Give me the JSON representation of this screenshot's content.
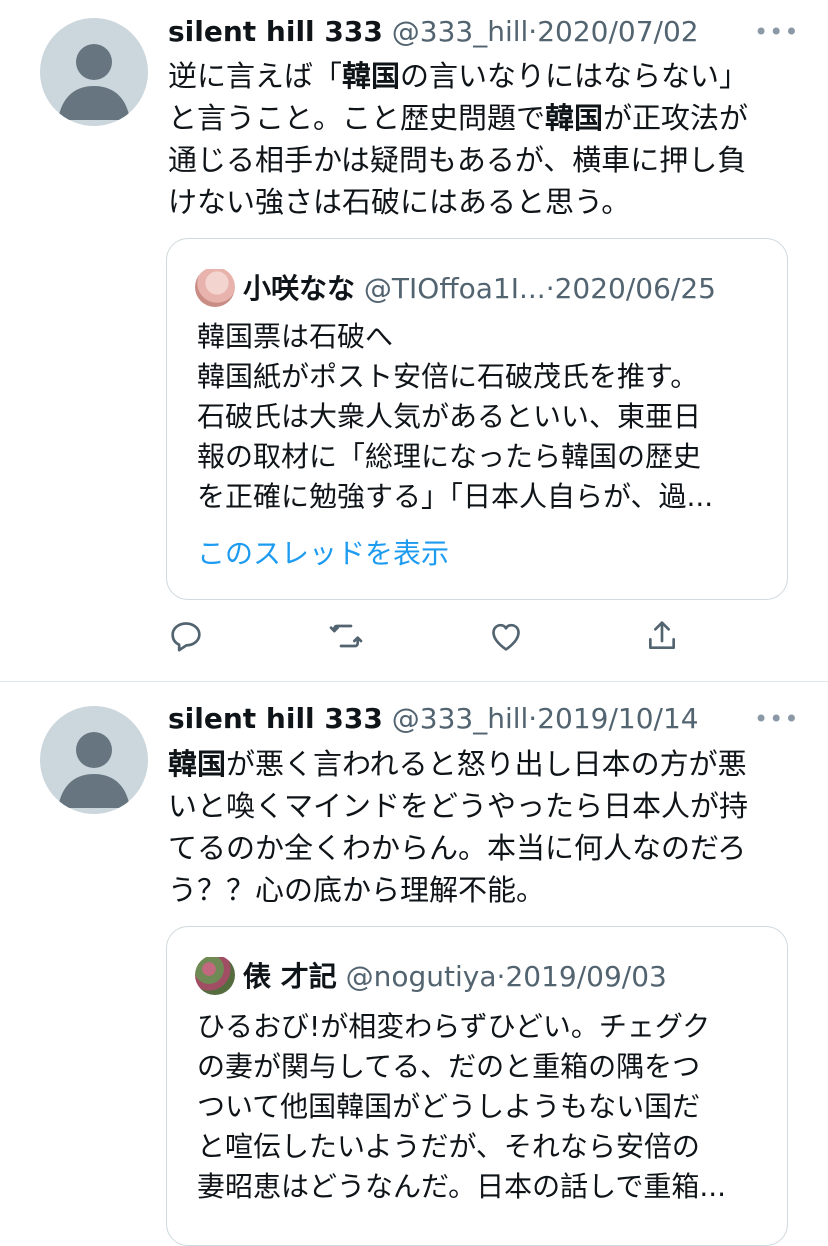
{
  "tweets": [
    {
      "name": "silent hill 333",
      "handle": "@333_hill",
      "separator": "·",
      "date": "2020/07/02",
      "more_label": "•••",
      "text_lines": [
        [
          {
            "t": "逆に言えば「"
          },
          {
            "t": "韓国",
            "b": true
          },
          {
            "t": "の言いなりにはならない」"
          }
        ],
        [
          {
            "t": "と言うこと。こと歴史問題で"
          },
          {
            "t": "韓国",
            "b": true
          },
          {
            "t": "が正攻法が"
          }
        ],
        [
          {
            "t": "通じる相手かは疑問もあるが、横車に押し負"
          }
        ],
        [
          {
            "t": "けない強さは石破にはあると思う。"
          }
        ]
      ],
      "quote": {
        "name": "小咲なな",
        "handle": "@TIOffoa1I...",
        "separator": "·",
        "date": "2020/06/25",
        "lines": [
          "韓国票は石破へ",
          "韓国紙がポスト安倍に石破茂氏を推す。",
          "石破氏は大衆人気があるといい、東亜日",
          "報の取材に「総理になったら韓国の歴史",
          "を正確に勉強する」「日本人自らが、過..."
        ],
        "show_thread": "このスレッドを表示"
      },
      "actions": [
        "reply-icon",
        "retweet-icon",
        "like-icon",
        "share-icon"
      ]
    },
    {
      "name": "silent hill 333",
      "handle": "@333_hill",
      "separator": "·",
      "date": "2019/10/14",
      "more_label": "•••",
      "text_lines": [
        [
          {
            "t": "韓国",
            "b": true
          },
          {
            "t": "が悪く言われると怒り出し日本の方が悪"
          }
        ],
        [
          {
            "t": "いと喚くマインドをどうやったら日本人が持"
          }
        ],
        [
          {
            "t": "てるのか全くわからん。本当に何人なのだろ"
          }
        ],
        [
          {
            "t": "う？？心の底から理解不能。"
          }
        ]
      ],
      "quote": {
        "name": "俵 才記",
        "handle": "@nogutiya",
        "separator": "·",
        "date": "2019/09/03",
        "lines": [
          "ひるおび!が相変わらずひどい。チェグク",
          "の妻が関与してる、だのと重箱の隅をつ",
          "ついて他国韓国がどうしようもない国だ",
          "と喧伝したいようだが、それなら安倍の",
          "妻昭恵はどうなんだ。日本の話しで重箱..."
        ]
      }
    }
  ]
}
